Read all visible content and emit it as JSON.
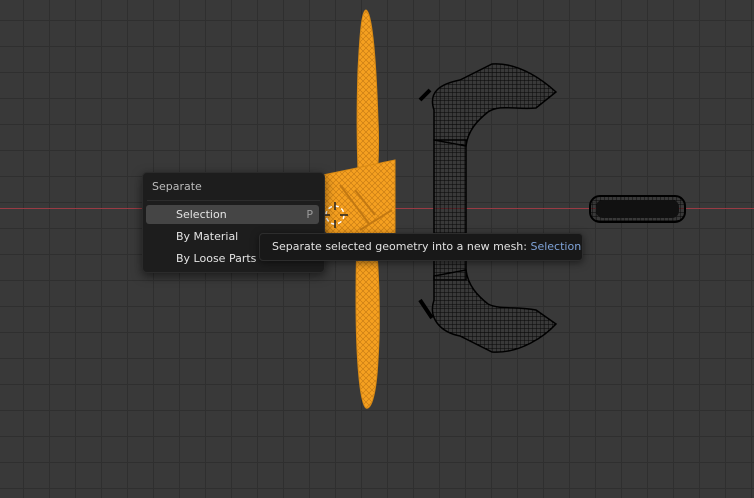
{
  "menu": {
    "title": "Separate",
    "items": [
      {
        "label": "Selection",
        "shortcut": "P",
        "active": true
      },
      {
        "label": "By Material",
        "shortcut": "",
        "active": false
      },
      {
        "label": "By Loose Parts",
        "shortcut": "",
        "active": false
      }
    ]
  },
  "tooltip": {
    "text": "Separate selected geometry into a new mesh: ",
    "highlight": "Selection"
  },
  "colors": {
    "selected_mesh": "#f5a020",
    "unselected_wire": "#000000",
    "x_axis": "#9a3b44",
    "highlight": "#7fa3d8"
  },
  "icons": {
    "cursor": "3d-cursor-icon"
  }
}
